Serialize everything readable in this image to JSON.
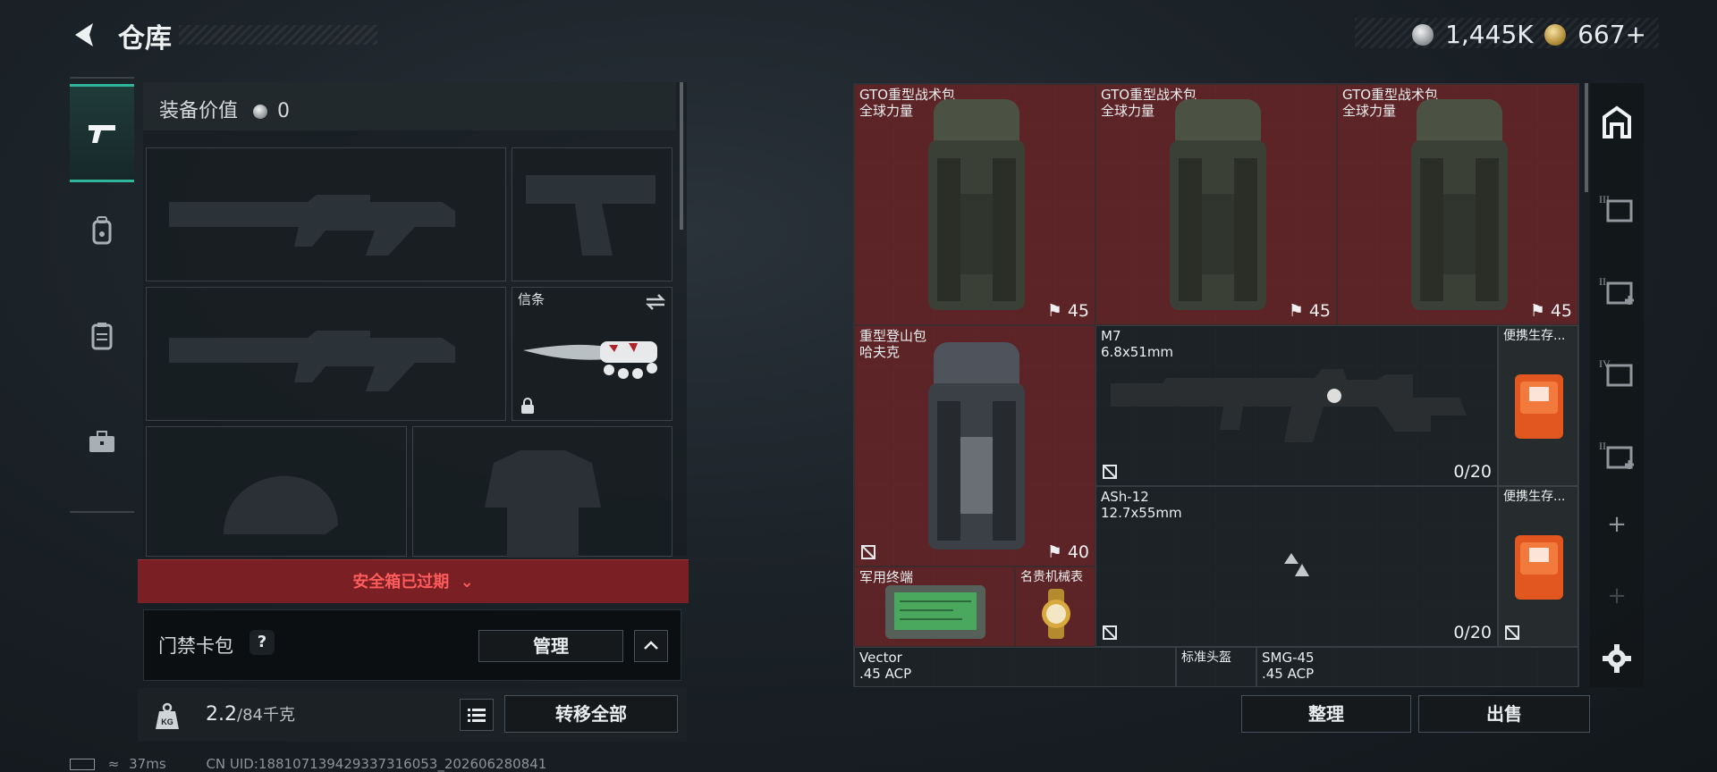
{
  "header": {
    "title": "仓库",
    "currencies": [
      {
        "icon": "silver-coin-icon",
        "value": "1,445K"
      },
      {
        "icon": "gold-coin-icon",
        "value": "667+"
      }
    ]
  },
  "left_tabs": [
    {
      "icon": "pistol-icon",
      "active": true
    },
    {
      "icon": "backpack-icon",
      "active": false
    },
    {
      "icon": "vest-icon",
      "active": false
    },
    {
      "icon": "briefcase-icon",
      "active": false
    }
  ],
  "loadout": {
    "value_label": "装备价值",
    "value": "0",
    "melee_label": "信条",
    "safebox_status": "安全箱已过期",
    "access_card_label": "门禁卡包",
    "help_label": "?",
    "manage_label": "管理",
    "weight_current": "2.2",
    "weight_max": "/84千克",
    "weight_icon_text": "KG",
    "transfer_all_label": "转移全部"
  },
  "inventory": {
    "items": [
      {
        "name": "GTO重型战术包\n全球力量",
        "count": "45",
        "tag": "backpack-1"
      },
      {
        "name": "GTO重型战术包\n全球力量",
        "count": "45",
        "tag": "backpack-2"
      },
      {
        "name": "GTO重型战术包\n全球力量",
        "count": "45",
        "tag": "backpack-3"
      },
      {
        "name": "重型登山包\n哈夫克",
        "count": "40",
        "tag": "backpack-4"
      },
      {
        "name": "M7\n6.8x51mm",
        "count": "0/20",
        "tag": "rifle-m7"
      },
      {
        "name": "便携生存...",
        "tag": "survival-kit-1"
      },
      {
        "name": "ASh-12\n12.7x55mm",
        "count": "0/20",
        "tag": "rifle-ash12"
      },
      {
        "name": "便携生存...",
        "tag": "survival-kit-2"
      },
      {
        "name": "军用终端",
        "tag": "military-terminal"
      },
      {
        "name": "名贵机械表",
        "tag": "luxury-watch"
      },
      {
        "name": "Vector\n.45 ACP",
        "tag": "smg-vector"
      },
      {
        "name": "标准头盔",
        "tag": "standard-helmet"
      },
      {
        "name": "SMG-45\n.45 ACP",
        "tag": "smg-45"
      }
    ],
    "sort_label": "整理",
    "sell_label": "出售"
  },
  "right_tabs": [
    {
      "icon": "storage-home-icon"
    },
    {
      "icon": "storage-tab-3-icon",
      "label": "III"
    },
    {
      "icon": "storage-tab-2-icon",
      "label": "II"
    },
    {
      "icon": "storage-tab-4-icon",
      "label": "IV"
    },
    {
      "icon": "storage-tab-2b-icon",
      "label": "II"
    },
    {
      "icon": "add-tab-icon",
      "label": "+"
    },
    {
      "icon": "add-tab-disabled-icon",
      "label": "+"
    },
    {
      "icon": "settings-icon"
    }
  ],
  "status_bar": {
    "ping": "37ms",
    "uid": "CN UID:188107139429337316053_202606280841"
  }
}
